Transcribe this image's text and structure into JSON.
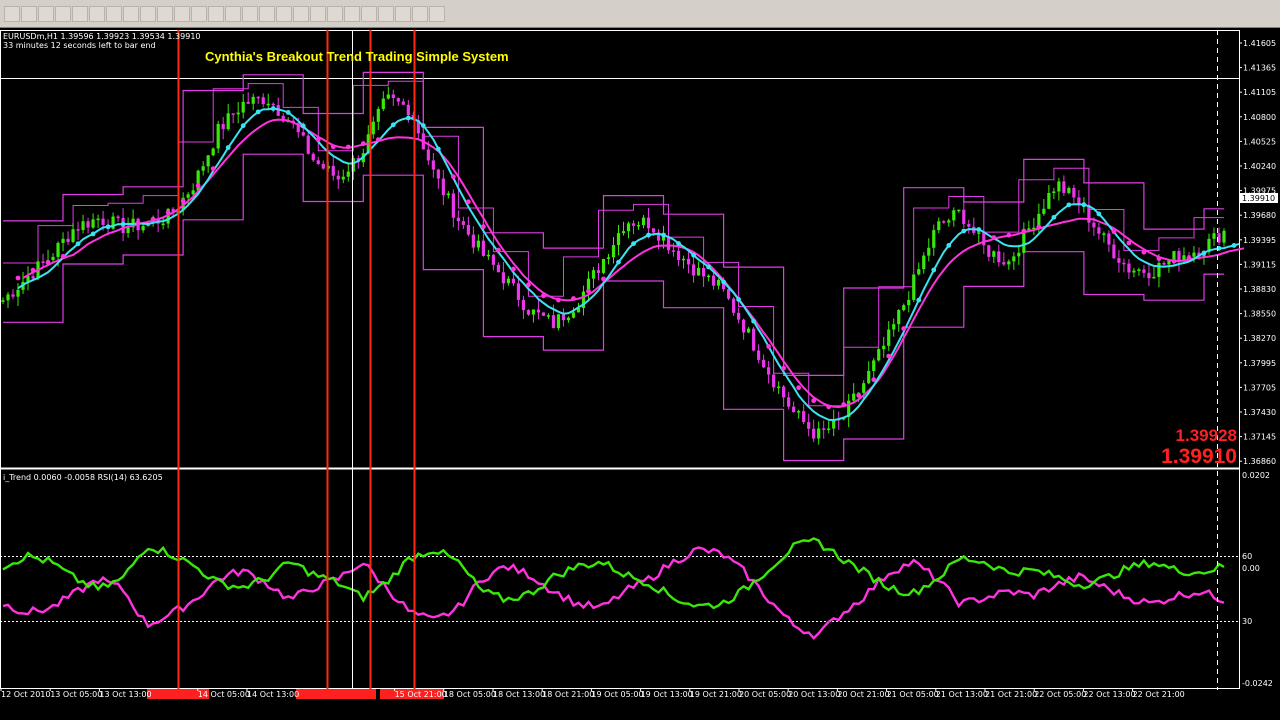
{
  "chart": {
    "symbol_line": "EURUSDm,H1  1.39596 1.39923 1.39534 1.39910",
    "bar_timer": "33 minutes 12 seconds left to bar end",
    "title": "Cynthia's Breakout Trend Trading Simple System",
    "bid_price": "1.39928",
    "ask_price": "1.39910",
    "current_price_label": "1.39910",
    "indicator_line": "i_Trend 0.0060 -0.0058  RSI(14) 63.6205"
  },
  "price_axis": [
    "1.41605",
    "1.41365",
    "1.41105",
    "1.40800",
    "1.40525",
    "1.40240",
    "1.39975",
    "1.39680",
    "1.39395",
    "1.39115",
    "1.38830",
    "1.38550",
    "1.38270",
    "1.37995",
    "1.37705",
    "1.37430",
    "1.37145",
    "1.36860"
  ],
  "indicator_axis": [
    "0.0202",
    "60",
    "0.00",
    "30",
    "-0.0242"
  ],
  "time_axis": [
    "12 Oct 2010",
    "13 Oct 05:00",
    "13 Oct 13:00",
    "",
    "14 Oct 05:00",
    "14 Oct 13:00",
    "",
    "",
    "15 Oct 21:00",
    "18 Oct 05:00",
    "18 Oct 13:00",
    "18 Oct 21:00",
    "19 Oct 05:00",
    "19 Oct 13:00",
    "19 Oct 21:00",
    "20 Oct 05:00",
    "20 Oct 13:00",
    "20 Oct 21:00",
    "21 Oct 05:00",
    "21 Oct 13:00",
    "21 Oct 21:00",
    "22 Oct 05:00",
    "22 Oct 13:00",
    "22 Oct 21:00"
  ],
  "colors": {
    "bull": "#39e80a",
    "bear": "#e838e8",
    "cyan": "#3ae3f0",
    "magenta": "#ff33dd",
    "env": "#e03de8",
    "vline": "#ff2a10",
    "title": "#ffff00"
  },
  "chart_data": {
    "type": "candlestick",
    "close_path": [
      1.3872,
      1.3898,
      1.3922,
      1.3955,
      1.3965,
      1.3955,
      1.3958,
      1.3968,
      1.4005,
      1.4065,
      1.4095,
      1.4102,
      1.4075,
      1.403,
      1.401,
      1.404,
      1.41,
      1.409,
      1.4015,
      1.3965,
      1.3925,
      1.3895,
      1.386,
      1.3845,
      1.387,
      1.3915,
      1.3962,
      1.396,
      1.393,
      1.3905,
      1.3885,
      1.384,
      1.379,
      1.3745,
      1.3718,
      1.3735,
      1.378,
      1.383,
      1.389,
      1.3955,
      1.3972,
      1.393,
      1.3915,
      1.396,
      1.4005,
      1.398,
      1.394,
      1.3908,
      1.3905,
      1.3922,
      1.393,
      1.395
    ],
    "rsi_path": [
      58,
      63,
      60,
      52,
      47,
      52,
      68,
      64,
      58,
      50,
      48,
      52,
      60,
      54,
      50,
      43,
      50,
      62,
      66,
      60,
      46,
      42,
      45,
      53,
      58,
      60,
      54,
      50,
      43,
      39,
      40,
      47,
      57,
      67,
      70,
      62,
      55,
      48,
      45,
      52,
      62,
      60,
      55,
      56,
      53,
      49,
      52,
      57,
      60,
      56,
      55,
      58
    ],
    "trend_path": [
      40,
      36,
      38,
      45,
      52,
      47,
      30,
      35,
      42,
      52,
      56,
      50,
      42,
      48,
      52,
      60,
      48,
      36,
      32,
      38,
      52,
      58,
      54,
      46,
      40,
      38,
      46,
      52,
      60,
      66,
      64,
      55,
      42,
      30,
      25,
      35,
      44,
      55,
      60,
      52,
      40,
      43,
      46,
      44,
      49,
      53,
      48,
      43,
      40,
      44,
      46,
      42
    ]
  }
}
